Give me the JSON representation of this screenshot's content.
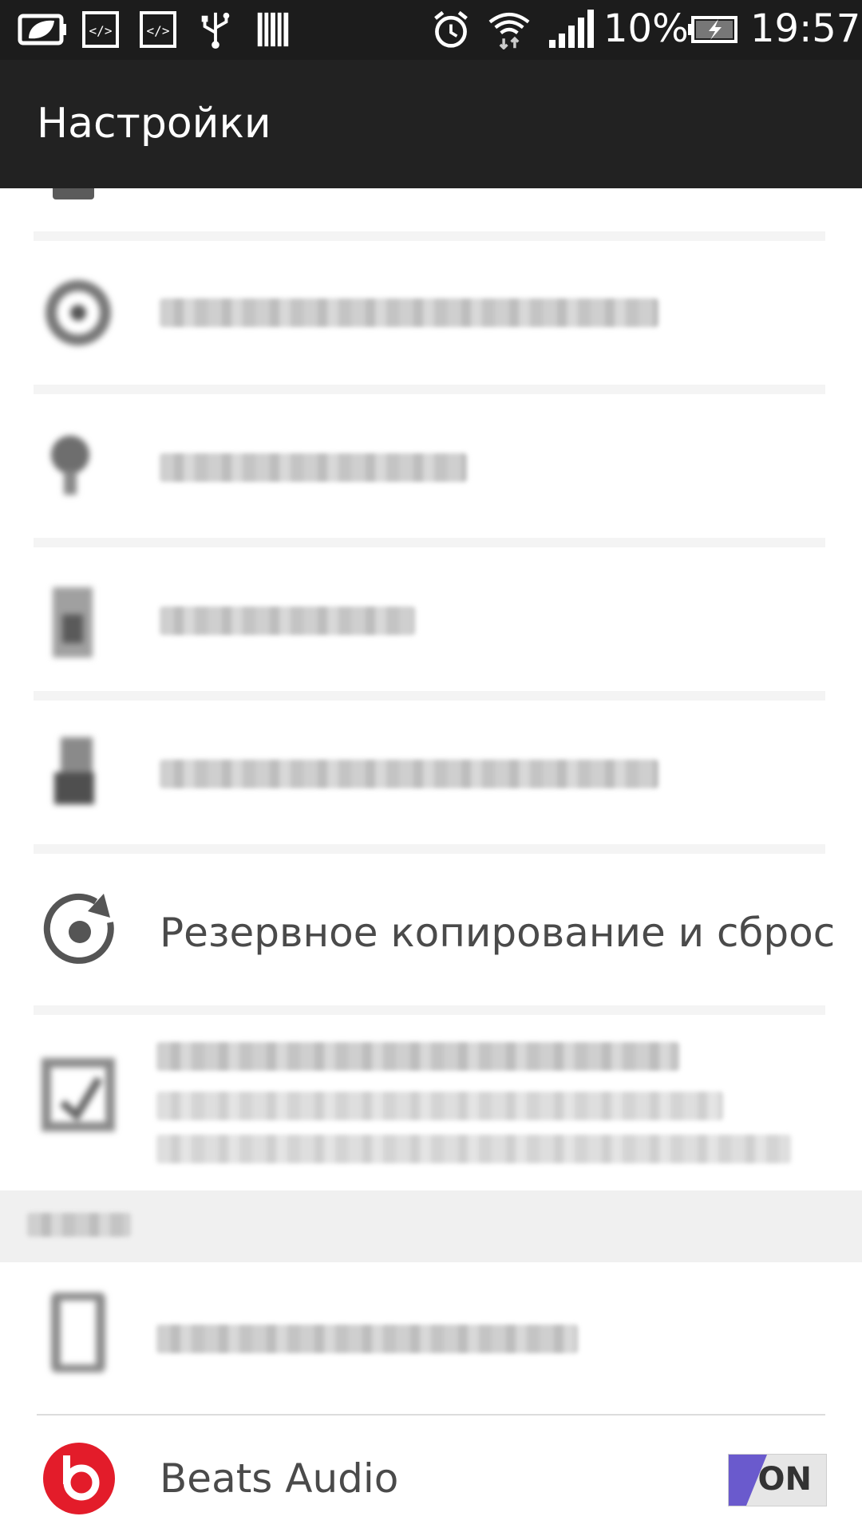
{
  "status_bar": {
    "battery_percent": "10%",
    "time": "19:57",
    "icons": [
      "leaf-battery-saver-icon",
      "code-icon",
      "code-icon",
      "usb-icon",
      "barcode-icon",
      "alarm-icon",
      "wifi-icon",
      "signal-icon",
      "battery-charging-icon"
    ]
  },
  "action_bar": {
    "title": "Настройки"
  },
  "settings": {
    "backup_reset_label": "Резервное копирование и сброс",
    "beats_audio_label": "Beats Audio",
    "beats_audio_toggle": "ON"
  },
  "colors": {
    "status_bar_bg": "#1c1c1c",
    "action_bar_bg": "#222222",
    "toggle_accent": "#6a5acd",
    "beats_red": "#e31c2a"
  }
}
